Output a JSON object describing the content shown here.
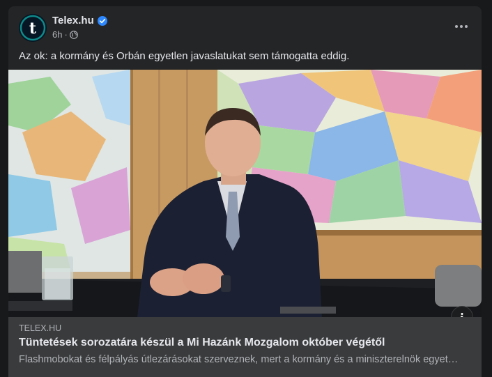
{
  "post": {
    "page_name": "Telex.hu",
    "verified_icon": "verified-badge-icon",
    "time": "6h",
    "separator": "·",
    "audience_icon": "globe-icon",
    "more_icon": "more-options-icon",
    "text": "Az ok: a kormány és Orbán egyetlen javaslatukat sem támogatta eddig."
  },
  "avatar": {
    "letter": "t",
    "brand_color": "#0f8a8a"
  },
  "link_preview": {
    "domain": "TELEX.HU",
    "title": "Tüntetések sorozatára készül a Mi Hazánk Mozgalom október végétől",
    "description": "Flashmobokat és félpályás útlezárásokat szerveznek, mert a kormány és a miniszterelnök egyet…",
    "info_icon": "info-icon"
  },
  "colors": {
    "background": "#18191a",
    "card": "#242526",
    "link_box": "#3a3b3c",
    "verified": "#2d88ff"
  }
}
